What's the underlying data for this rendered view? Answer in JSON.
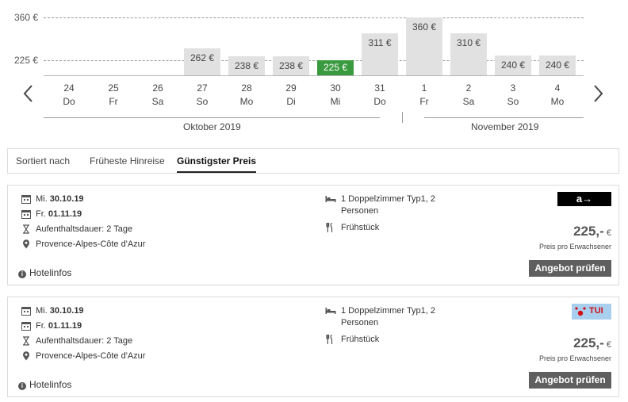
{
  "chart_data": {
    "type": "bar",
    "y_ticks": [
      "360 €",
      "225 €"
    ],
    "ylim": [
      200,
      360
    ],
    "categories": [
      "24",
      "25",
      "26",
      "27",
      "28",
      "29",
      "30",
      "31",
      "1",
      "2",
      "3",
      "4"
    ],
    "weekdays": [
      "Do",
      "Fr",
      "Sa",
      "So",
      "Mo",
      "Di",
      "Mi",
      "Do",
      "Fr",
      "Sa",
      "So",
      "Mo"
    ],
    "values": [
      null,
      null,
      null,
      262,
      238,
      238,
      225,
      311,
      360,
      310,
      240,
      240
    ],
    "labels": [
      "",
      "",
      "",
      "262 €",
      "238 €",
      "238 €",
      "225 €",
      "311 €",
      "360 €",
      "310 €",
      "240 €",
      "240 €"
    ],
    "selected_index": 6,
    "selected_color": "#3a9a3f",
    "bar_color": "#e1e1e1",
    "months": [
      "Oktober 2019",
      "November 2019"
    ],
    "grid": true
  },
  "nav": {
    "prev_icon": "chevron-left-icon",
    "next_icon": "chevron-right-icon"
  },
  "sort": {
    "label": "Sortiert nach",
    "options": [
      "Früheste Hinreise",
      "Günstigster Preis"
    ],
    "active": "Günstigster Preis"
  },
  "offers": [
    {
      "depart_prefix": "Mi.",
      "depart_date": "30.10.19",
      "return_prefix": "Fr.",
      "return_date": "01.11.19",
      "duration": "Aufenthaltsdauer: 2 Tage",
      "region": "Provence-Alpes-Côte d'Azur",
      "hotelinfo": "Hotelinfos",
      "room": "1 Doppelzimmer Typ1, 2 Personen",
      "board": "Frühstück",
      "provider_logo": "a→",
      "provider_icon": "ab-in-den-urlaub-logo",
      "price": "225,-",
      "currency": "€",
      "price_note": "Preis pro Erwachsener",
      "button": "Angebot prüfen"
    },
    {
      "depart_prefix": "Mi.",
      "depart_date": "30.10.19",
      "return_prefix": "Fr.",
      "return_date": "01.11.19",
      "duration": "Aufenthaltsdauer: 2 Tage",
      "region": "Provence-Alpes-Côte d'Azur",
      "hotelinfo": "Hotelinfos",
      "room": "1 Doppelzimmer Typ1, 2 Personen",
      "board": "Frühstück",
      "provider_logo": "TUI",
      "provider_icon": "tui-logo",
      "price": "225,-",
      "currency": "€",
      "price_note": "Preis pro Erwachsener",
      "button": "Angebot prüfen"
    }
  ]
}
